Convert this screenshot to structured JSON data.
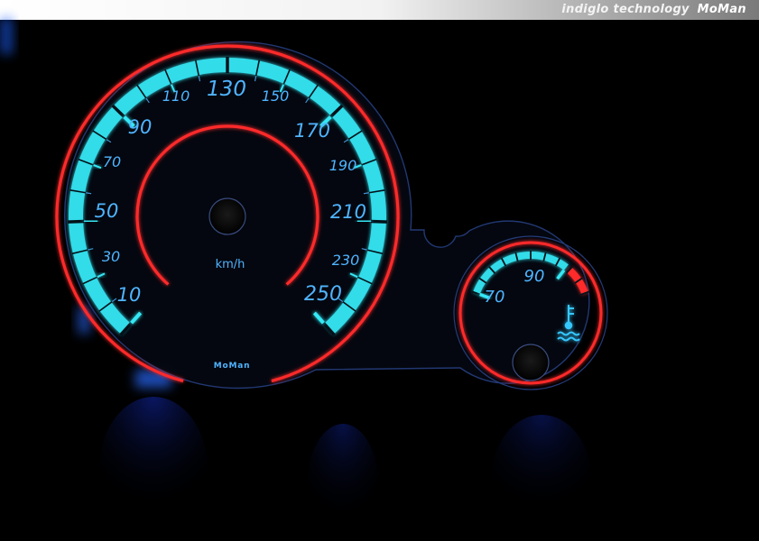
{
  "banner": {
    "tagline": "indiglo technology",
    "brand": "MoMan"
  },
  "speedometer": {
    "unit": "km/h",
    "major_labels": [
      "10",
      "50",
      "90",
      "130",
      "170",
      "210",
      "250"
    ],
    "minor_labels": [
      "30",
      "70",
      "110",
      "150",
      "190",
      "230"
    ],
    "brand_mark": "MoMan"
  },
  "temperature_gauge": {
    "labels": [
      "70",
      "90"
    ],
    "icon": "coolant-temperature-icon",
    "warning_zone": "red"
  },
  "colors": {
    "background": "#000000",
    "indiglo_cyan": "#35e8f5",
    "ring_red": "#ff2a2a",
    "label_blue": "#4fb4ff",
    "glow_blue": "#1e60ff"
  }
}
